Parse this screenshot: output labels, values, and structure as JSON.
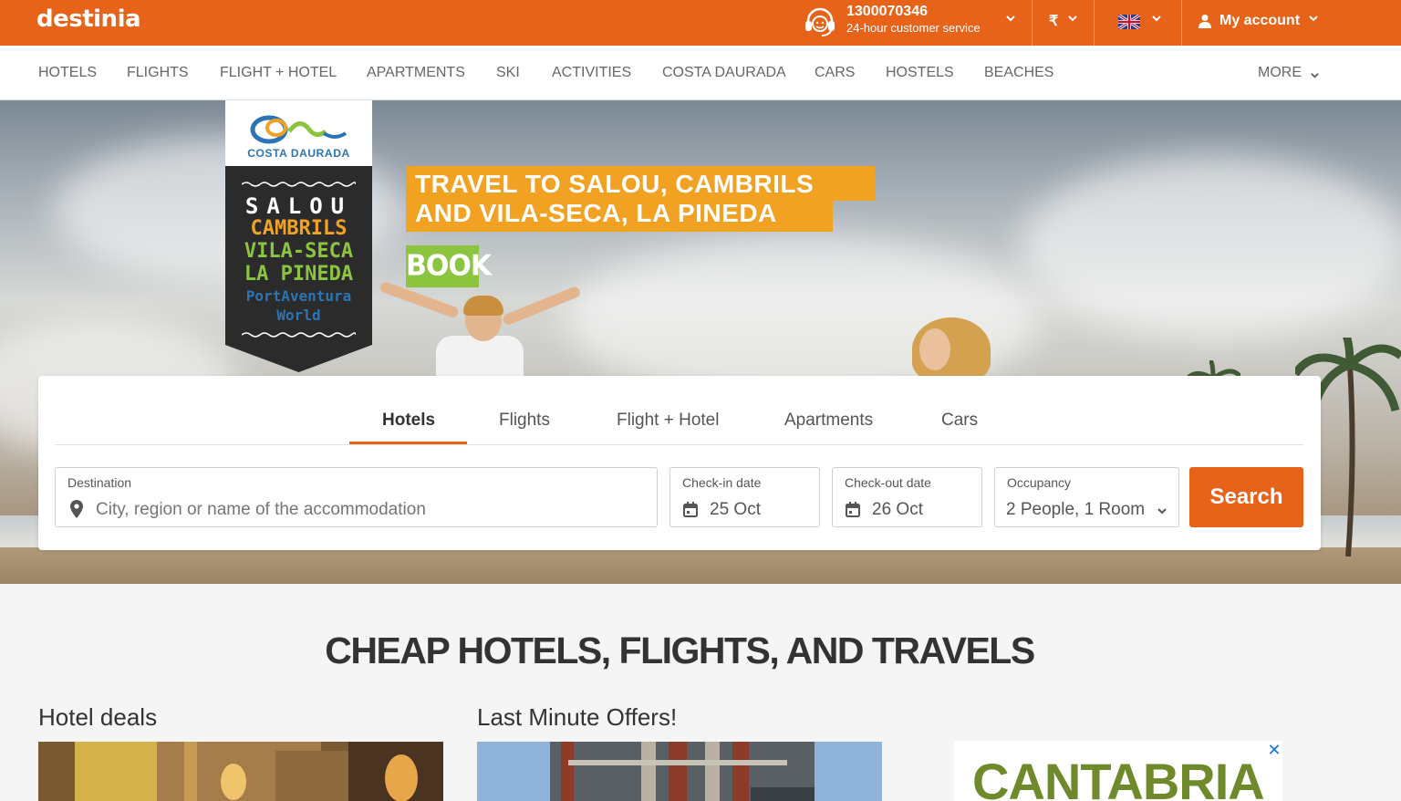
{
  "brand": {
    "logo": "destinia",
    "accent": "#e8631a"
  },
  "topbar": {
    "phone_number": "1300070346",
    "phone_sub": "24-hour customer service",
    "currency_symbol": "₹",
    "account_label": "My account"
  },
  "nav": {
    "items": [
      "HOTELS",
      "FLIGHTS",
      "FLIGHT + HOTEL",
      "APARTMENTS",
      "SKI",
      "ACTIVITIES",
      "COSTA DAURADA",
      "CARS",
      "HOSTELS",
      "BEACHES"
    ],
    "more": "MORE"
  },
  "hero": {
    "badge_brand": "COSTA DAURADA",
    "badge_lines": [
      "SALOU",
      "CAMBRILS",
      "VILA-SECA",
      "LA PINEDA",
      "PortAventura",
      "World"
    ],
    "promo_line1": "TRAVEL TO SALOU, CAMBRILS",
    "promo_line2": "AND VILA-SECA, LA PINEDA",
    "book_label": "BOOK"
  },
  "search": {
    "tabs": [
      "Hotels",
      "Flights",
      "Flight + Hotel",
      "Apartments",
      "Cars"
    ],
    "active_tab": "Hotels",
    "destination": {
      "label": "Destination",
      "placeholder": "City, region or name of the accommodation",
      "value": ""
    },
    "checkin": {
      "label": "Check-in date",
      "value": "25 Oct"
    },
    "checkout": {
      "label": "Check-out date",
      "value": "26 Oct"
    },
    "occupancy": {
      "label": "Occupancy",
      "value": "2 People, 1 Room"
    },
    "button": "Search"
  },
  "content": {
    "heading": "CHEAP HOTELS, FLIGHTS, AND TRAVELS",
    "hotel_deals": "Hotel deals",
    "last_minute": "Last Minute Offers!",
    "ad_text": "CANTABRIA",
    "ad_close": "✕"
  }
}
